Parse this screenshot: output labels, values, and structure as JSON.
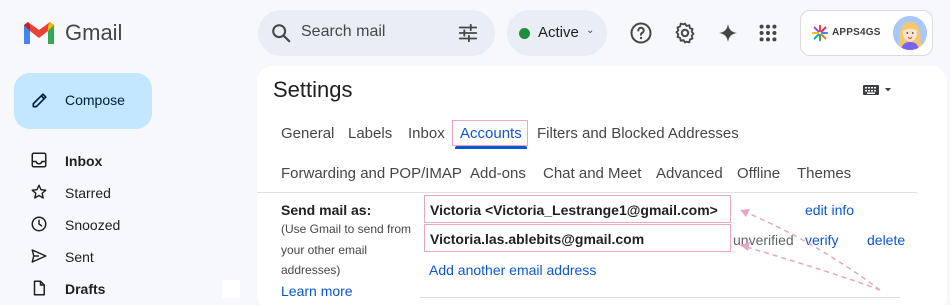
{
  "app": {
    "name": "Gmail"
  },
  "search": {
    "placeholder": "Search mail"
  },
  "status": {
    "label": "Active",
    "color": "#1e8e3e"
  },
  "account": {
    "brand": "APPS4GS"
  },
  "sidebar": {
    "compose_label": "Compose",
    "items": [
      {
        "label": "Inbox",
        "icon": "inbox-icon",
        "bold": true
      },
      {
        "label": "Starred",
        "icon": "star-icon",
        "bold": false
      },
      {
        "label": "Snoozed",
        "icon": "clock-icon",
        "bold": false
      },
      {
        "label": "Sent",
        "icon": "send-icon",
        "bold": false
      },
      {
        "label": "Drafts",
        "icon": "draft-icon",
        "bold": true
      }
    ]
  },
  "settings": {
    "title": "Settings",
    "tabs_row1": [
      "General",
      "Labels",
      "Inbox",
      "Accounts",
      "Filters and Blocked Addresses"
    ],
    "tabs_row2": [
      "Forwarding and POP/IMAP",
      "Add-ons",
      "Chat and Meet",
      "Advanced",
      "Offline",
      "Themes"
    ],
    "active_tab": "Accounts",
    "send_mail": {
      "label": "Send mail as:",
      "help_lines": [
        "(Use Gmail to send from",
        "your other email",
        "addresses)"
      ],
      "learn_more": "Learn more",
      "addresses": [
        {
          "email": "Victoria <Victoria_Lestrange1@gmail.com>",
          "status": "",
          "actions": [
            "edit info"
          ]
        },
        {
          "email": "Victoria.las.ablebits@gmail.com",
          "status": "unverified",
          "actions": [
            "verify",
            "delete"
          ]
        }
      ],
      "add_link": "Add another email address"
    }
  },
  "colors": {
    "accent": "#0b57d0",
    "compose_bg": "#c2e7ff",
    "highlight": "#e8a6c4"
  }
}
